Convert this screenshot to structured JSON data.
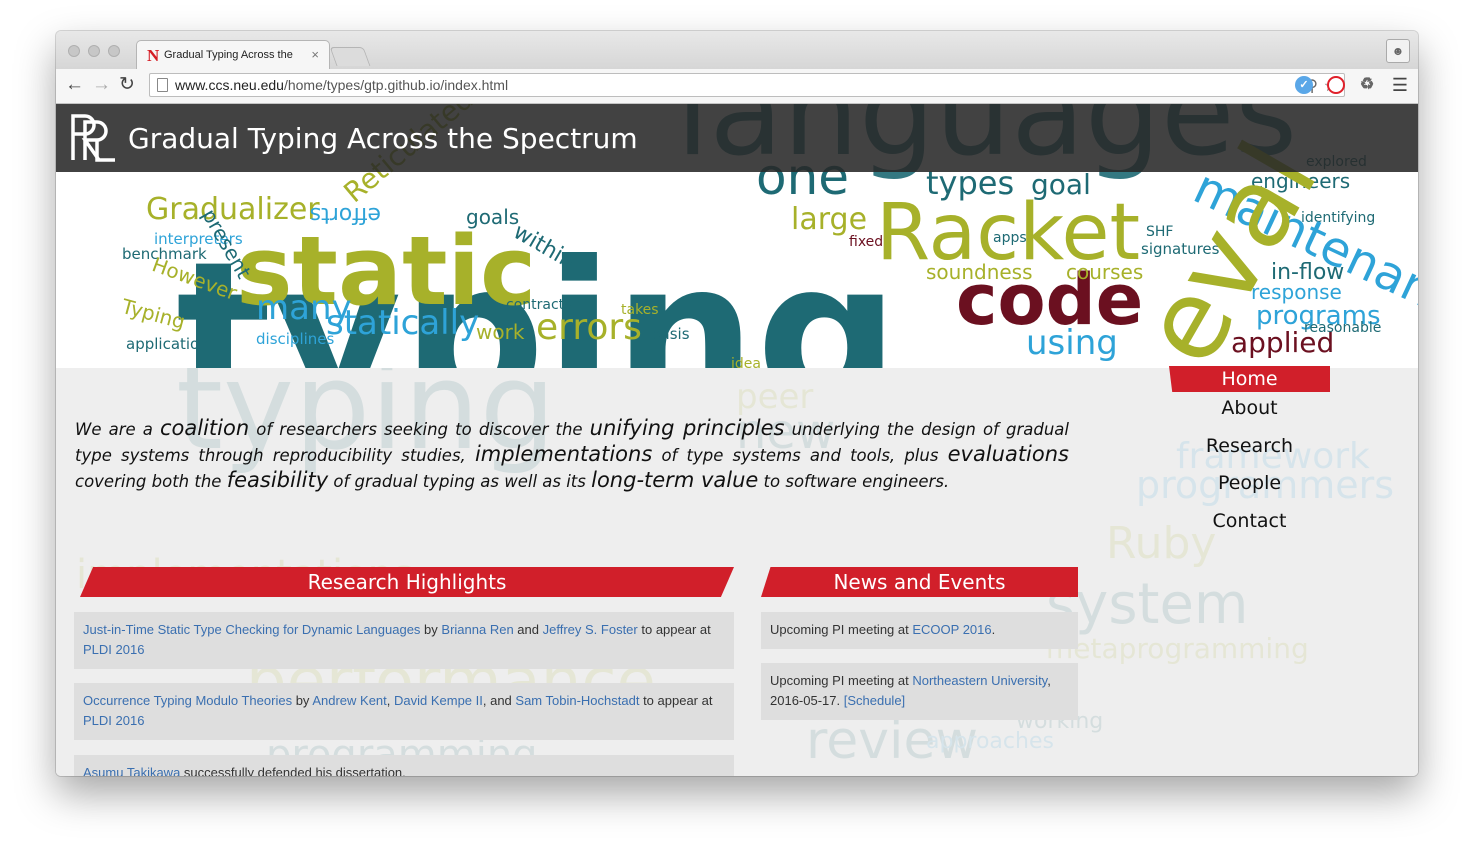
{
  "browser": {
    "tab_title": "Gradual Typing Across the",
    "tab_favicon": "N",
    "tab_close": "×",
    "url_host": "www.ccs.neu.edu",
    "url_path": "/home/types/gtp.github.io/index.html",
    "icons": [
      "back-arrow-icon",
      "forward-arrow-icon",
      "reload-icon",
      "page-icon",
      "zoom-icon",
      "bookmark-star-icon",
      "extension-icon",
      "opera-icon",
      "recycle-icon",
      "menu-icon",
      "profile-icon"
    ]
  },
  "site": {
    "title": "Gradual Typing Across the Spectrum",
    "logo_text": "PRL"
  },
  "intro": {
    "p1": "We are a ",
    "coalition": "coalition",
    "p2": " of researchers seeking to discover the ",
    "unifying": "unifying principles",
    "p3": " underlying the design of gradual type systems through reproducibility studies, ",
    "implementations": "implementations",
    "p4": " of type systems and tools, plus ",
    "evaluations": "evaluations",
    "p5": " covering both the ",
    "feasibility": "feasibility",
    "p6": " of gradual typing as well as its ",
    "longterm": "long-term value",
    "p7": " to software engineers."
  },
  "nav": {
    "home": "Home",
    "about": "About",
    "research": "Research",
    "people": "People",
    "contact": "Contact"
  },
  "highlights": {
    "header": "Research Highlights",
    "items": [
      {
        "paper": "Just-in-Time Static Type Checking for Dynamic Languages",
        "by": " by ",
        "author1": "Brianna Ren",
        "and": " and ",
        "author2": "Jeffrey S. Foster",
        "appear": " to appear at ",
        "venue": "PLDI 2016"
      },
      {
        "paper": "Occurrence Typing Modulo Theories",
        "by": " by ",
        "author1": "Andrew Kent",
        "comma": ", ",
        "author2": "David Kempe II",
        "and": ", and ",
        "author3": "Sam Tobin-Hochstadt",
        "appear": " to appear at ",
        "venue": "PLDI 2016"
      },
      {
        "person": "Asumu Takikawa",
        "text": " successfully defended his dissertation."
      }
    ]
  },
  "news": {
    "header": "News and Events",
    "items": [
      {
        "text": "Upcoming PI meeting at ",
        "link": "ECOOP 2016",
        "end": "."
      },
      {
        "text": "Upcoming PI meeting at ",
        "link": "Northeastern University",
        "mid": ", 2016-05-17. ",
        "schedule": "[Schedule]"
      }
    ]
  },
  "colors": {
    "accent_red": "#d11f2a",
    "link_blue": "#3a6fb0",
    "cloud_olive": "#a7b12a",
    "cloud_teal": "#1e6a74",
    "cloud_blue": "#2ea3d8",
    "cloud_maroon": "#6b1020"
  }
}
